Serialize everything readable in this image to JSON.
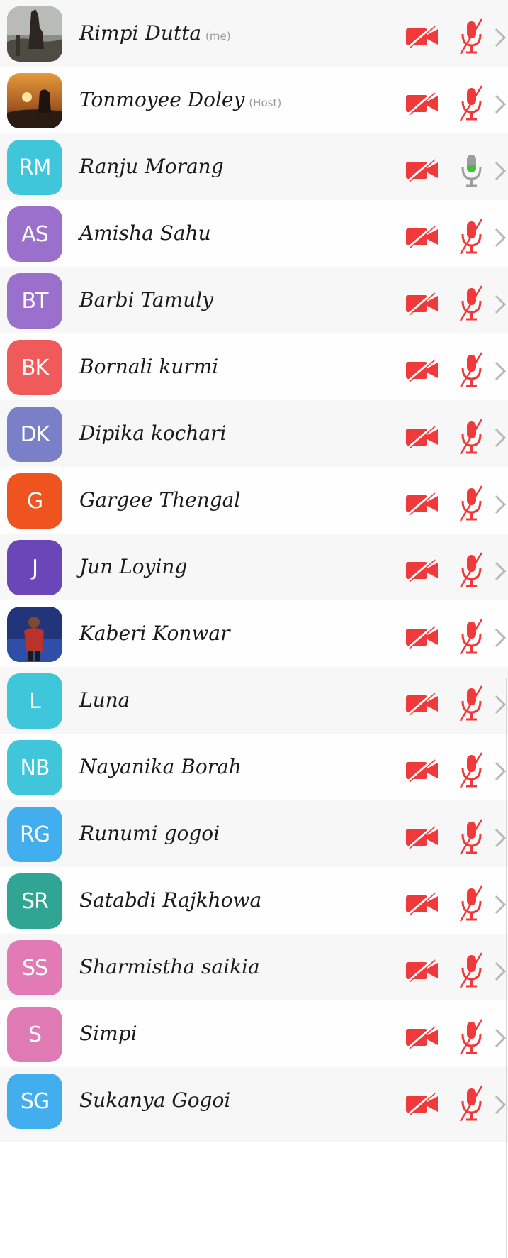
{
  "participants": [
    {
      "name": "Rimpi Dutta",
      "tag": "(me)",
      "initials": "",
      "avatar_kind": "photo-llama",
      "mic": "muted"
    },
    {
      "name": "Tonmoyee Doley",
      "tag": "(Host)",
      "initials": "",
      "avatar_kind": "photo-sunset",
      "mic": "muted"
    },
    {
      "name": "Ranju Morang",
      "tag": "",
      "initials": "RM",
      "color": "#3fc6da",
      "mic": "on"
    },
    {
      "name": "Amisha Sahu",
      "tag": "",
      "initials": "AS",
      "color": "#9a70cc",
      "mic": "muted"
    },
    {
      "name": "Barbi Tamuly",
      "tag": "",
      "initials": "BT",
      "color": "#9a70cc",
      "mic": "muted"
    },
    {
      "name": "Bornali kurmi",
      "tag": "",
      "initials": "BK",
      "color": "#f05a5a",
      "mic": "muted"
    },
    {
      "name": "Dipika kochari",
      "tag": "",
      "initials": "DK",
      "color": "#7a80c8",
      "mic": "muted"
    },
    {
      "name": "Gargee Thengal",
      "tag": "",
      "initials": "G",
      "color": "#f0541e",
      "mic": "muted"
    },
    {
      "name": "Jun Loying",
      "tag": "",
      "initials": "J",
      "color": "#6a46b8",
      "mic": "muted"
    },
    {
      "name": "Kaberi Konwar",
      "tag": "",
      "initials": "",
      "avatar_kind": "photo-stage",
      "mic": "muted"
    },
    {
      "name": "Luna",
      "tag": "",
      "initials": "L",
      "color": "#3fc6da",
      "mic": "muted"
    },
    {
      "name": "Nayanika Borah",
      "tag": "",
      "initials": "NB",
      "color": "#3fc6da",
      "mic": "muted"
    },
    {
      "name": "Runumi gogoi",
      "tag": "",
      "initials": "RG",
      "color": "#42aeee",
      "mic": "muted"
    },
    {
      "name": "Satabdi Rajkhowa",
      "tag": "",
      "initials": "SR",
      "color": "#31a593",
      "mic": "muted"
    },
    {
      "name": "Sharmistha saikia",
      "tag": "",
      "initials": "SS",
      "color": "#e27ab6",
      "mic": "muted"
    },
    {
      "name": "Simpi",
      "tag": "",
      "initials": "S",
      "color": "#e07ab4",
      "mic": "muted"
    },
    {
      "name": "Sukanya Gogoi",
      "tag": "",
      "initials": "SG",
      "color": "#42aeee",
      "mic": "muted"
    }
  ],
  "colors": {
    "muted_red": "#f0393a",
    "mic_on_green": "#3fc23a",
    "mic_on_gray": "#9d9d9d",
    "chevron": "#b8b8b8"
  },
  "icons": {
    "camera": "video-off-icon",
    "mic_muted": "mic-off-icon",
    "mic_on": "mic-on-icon",
    "chevron": "chevron-right-icon"
  }
}
